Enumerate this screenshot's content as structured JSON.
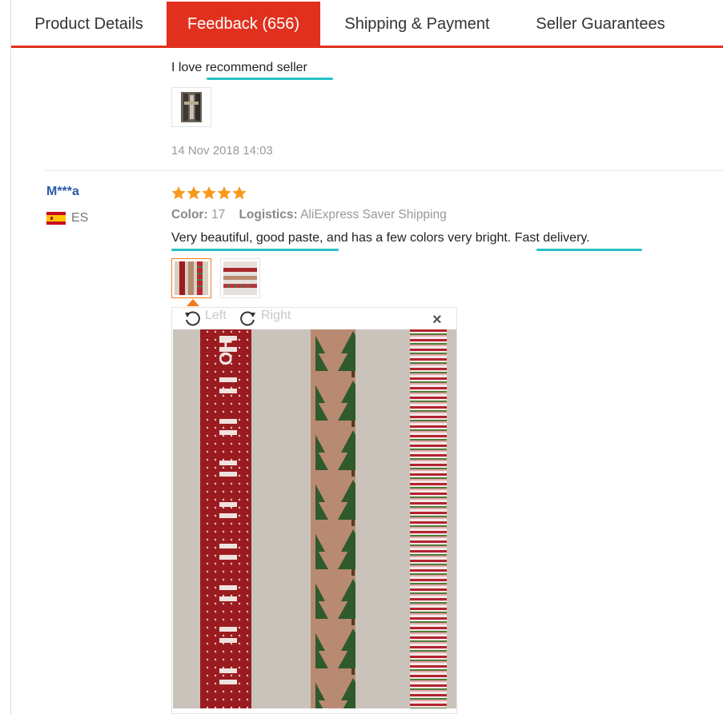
{
  "tabs": [
    {
      "label": "Product Details"
    },
    {
      "label": "Feedback (656)"
    },
    {
      "label": "Shipping & Payment"
    },
    {
      "label": "Seller Guarantees"
    }
  ],
  "previous_review": {
    "text": "I love recommend seller",
    "date": "14 Nov 2018 14:03"
  },
  "review": {
    "user": "M***a",
    "country": "ES",
    "rating": 5,
    "color_label": "Color:",
    "color_value": "17",
    "logistics_label": "Logistics:",
    "logistics_value": "AliExpress Saver Shipping",
    "text": "Very beautiful, good paste, and has a few colors very bright. Fast delivery.",
    "image_count": 2
  },
  "viewer": {
    "rotate_left": "Left",
    "rotate_right": "Right",
    "close": "×"
  },
  "colors": {
    "accent": "#e1311e",
    "highlight_underline": "#25c1c7",
    "star": "#f79a1c",
    "username": "#2a5aa8"
  }
}
